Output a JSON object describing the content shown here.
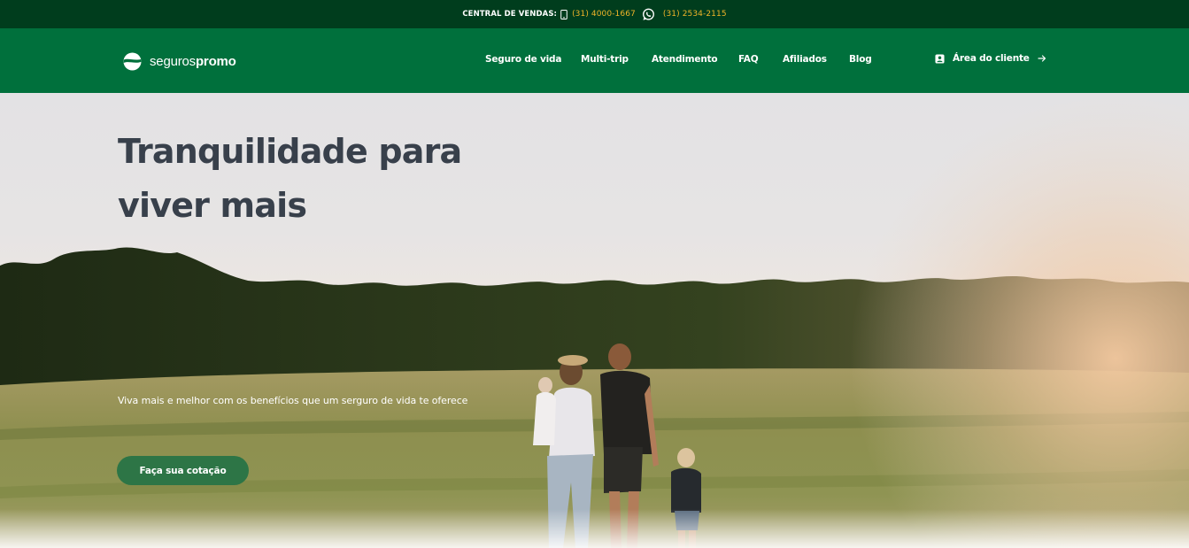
{
  "topbar": {
    "label": "CENTRAL DE VENDAS:",
    "phone": "(31) 4000-1667",
    "whatsapp": "(31) 2534-2115",
    "icons": [
      "phone-icon",
      "whatsapp-icon"
    ]
  },
  "header": {
    "logo": {
      "word1": "seguros",
      "word2": "promo"
    },
    "nav": [
      {
        "label": "Seguro de vida"
      },
      {
        "label": "Multi-trip"
      },
      {
        "label": "Atendimento"
      },
      {
        "label": "FAQ"
      },
      {
        "label": "Afiliados"
      },
      {
        "label": "Blog"
      }
    ],
    "client_area": "Área do cliente"
  },
  "hero": {
    "title_line1": "Tranquilidade para",
    "title_line2": "viver mais",
    "subtitle": "Viva mais e melhor com os benefícios que um serguro de vida te oferece",
    "cta": "Faça sua cotação"
  },
  "colors": {
    "topbar_bg": "#003d1d",
    "header_bg": "#00703c",
    "phone_text": "#f0b429",
    "cta_bg": "#2d7546",
    "title": "#38404b"
  }
}
